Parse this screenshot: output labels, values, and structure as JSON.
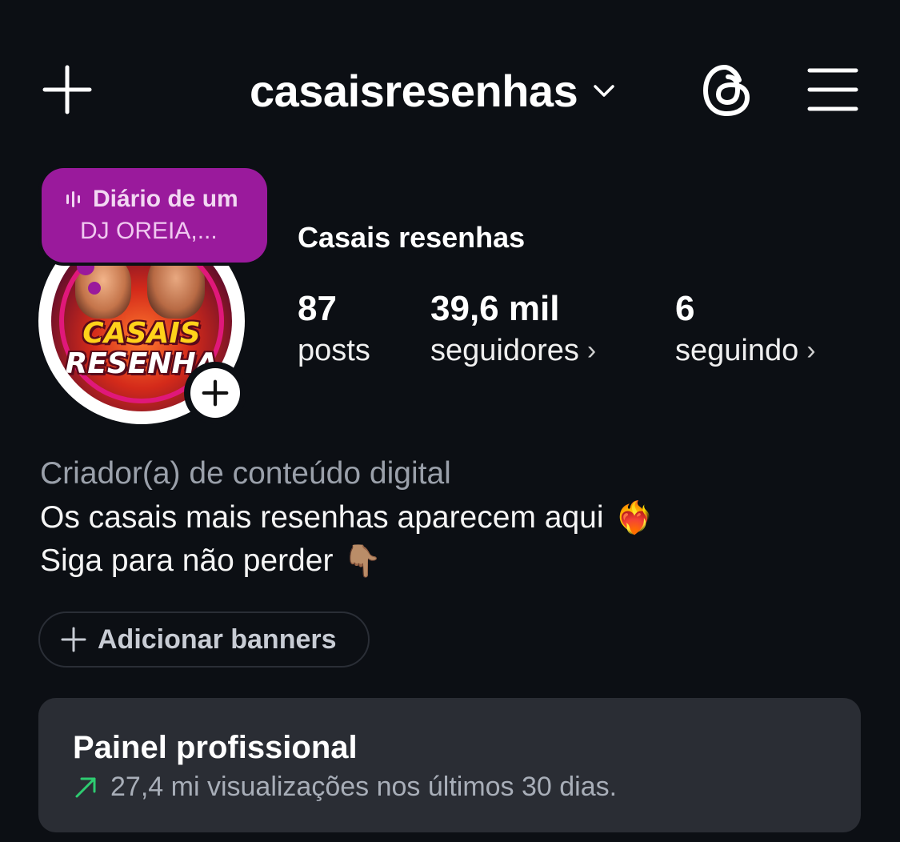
{
  "header": {
    "username": "casaisresenhas",
    "icons": {
      "create": "plus-icon",
      "account_switch": "chevron-down-icon",
      "threads": "threads-icon",
      "menu": "hamburger-menu-icon"
    }
  },
  "note": {
    "song": "Diário de um",
    "artist": "DJ OREIA,..."
  },
  "avatar": {
    "text_line1": "CASAIS",
    "text_line2": "RESENHA"
  },
  "profile": {
    "display_name": "Casais resenhas",
    "stats": {
      "posts": {
        "value": "87",
        "label": "posts"
      },
      "followers": {
        "value": "39,6 mil",
        "label": "seguidores"
      },
      "following": {
        "value": "6",
        "label": "seguindo"
      }
    },
    "chevron": "›"
  },
  "bio": {
    "category": "Criador(a) de conteúdo digital",
    "line1": "Os casais mais resenhas aparecem aqui",
    "line1_emoji": "❤️‍🔥",
    "line2": "Siga para não perder",
    "line2_emoji": "👇🏽"
  },
  "banner_button": {
    "label": "Adicionar banners"
  },
  "pro_panel": {
    "title": "Painel profissional",
    "subtitle": "27,4 mi visualizações nos últimos 30 dias.",
    "trend_color": "#2ecc71"
  },
  "colors": {
    "background": "#0c0f14",
    "note_bg": "#9a1a9c",
    "panel_bg": "#2a2d34"
  }
}
